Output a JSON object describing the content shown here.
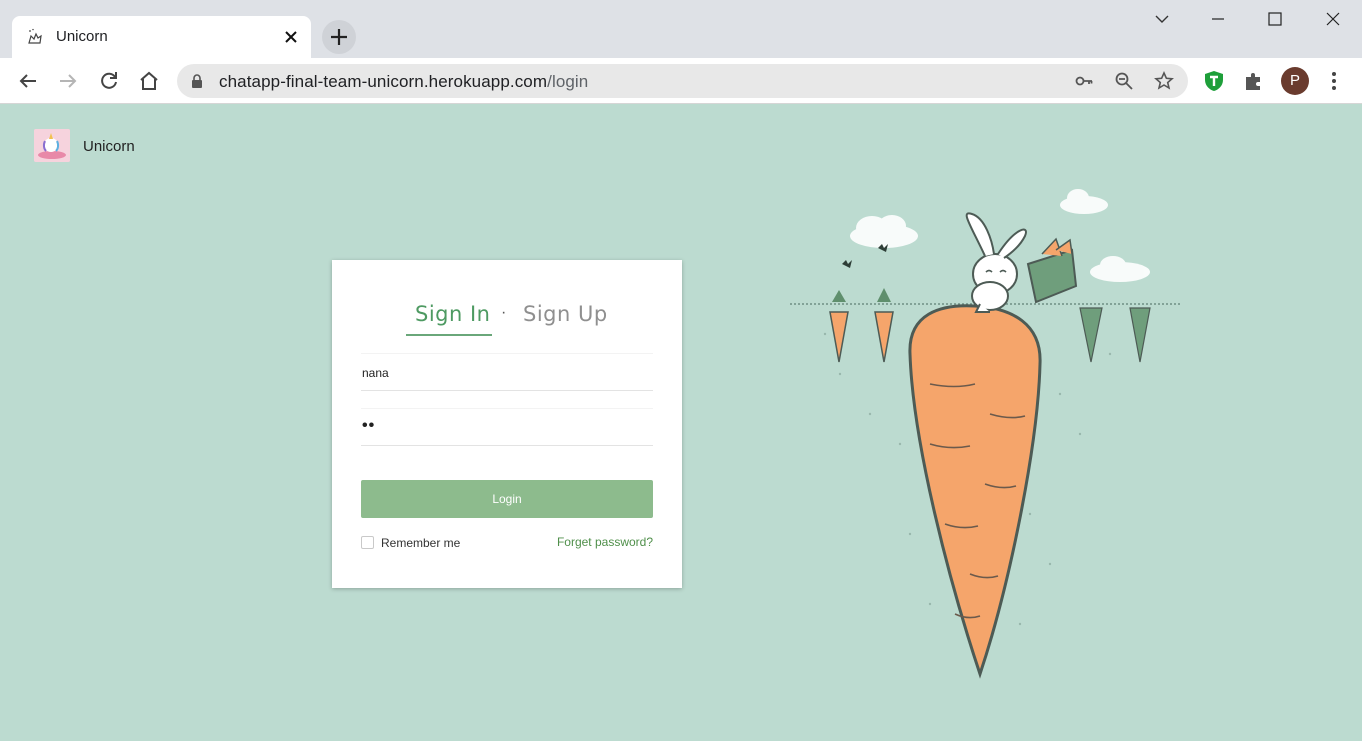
{
  "browser": {
    "tab_title": "Unicorn",
    "url_host": "chatapp-final-team-unicorn.herokuapp.com",
    "url_path": "/login",
    "profile_initial": "P"
  },
  "page": {
    "brand_name": "Unicorn",
    "login_card": {
      "tab_signin": "Sign In",
      "tab_separator": "·",
      "tab_signup": "Sign Up",
      "username_value": "nana",
      "password_value": "••",
      "login_button": "Login",
      "remember_label": "Remember me",
      "forgot_link": "Forget password?"
    }
  },
  "colors": {
    "page_bg": "#bcdbd0",
    "accent_green": "#4e9a62",
    "button_green": "#8dbb8d",
    "carrot_orange": "#f5a56b"
  }
}
